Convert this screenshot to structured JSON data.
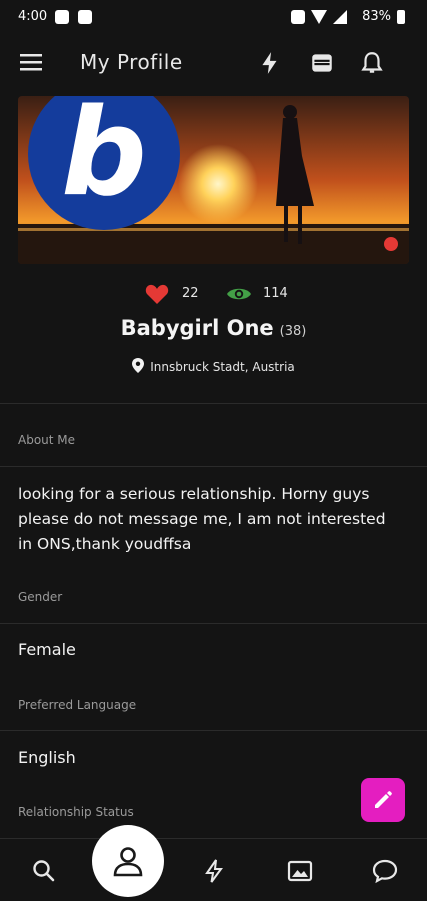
{
  "status_bar": {
    "time": "4:00",
    "battery": "83%"
  },
  "app_bar": {
    "title": "My Profile"
  },
  "profile": {
    "likes": "22",
    "views": "114",
    "name": "Babygirl One",
    "age": "(38)",
    "location": "Innsbruck Stadt, Austria",
    "banner_logo_letter": "b"
  },
  "sections": {
    "about_label": "About Me",
    "about_text": "looking for a serious relationship. Horny guys please do not message me, I am not interested in ONS,thank youdffsa",
    "gender_label": "Gender",
    "gender_value": "Female",
    "language_label": "Preferred Language",
    "language_value": "English",
    "relationship_label": "Relationship Status"
  },
  "colors": {
    "accent": "#e41ec0",
    "heart": "#e53935",
    "eye": "#43a047",
    "background": "#141414"
  }
}
